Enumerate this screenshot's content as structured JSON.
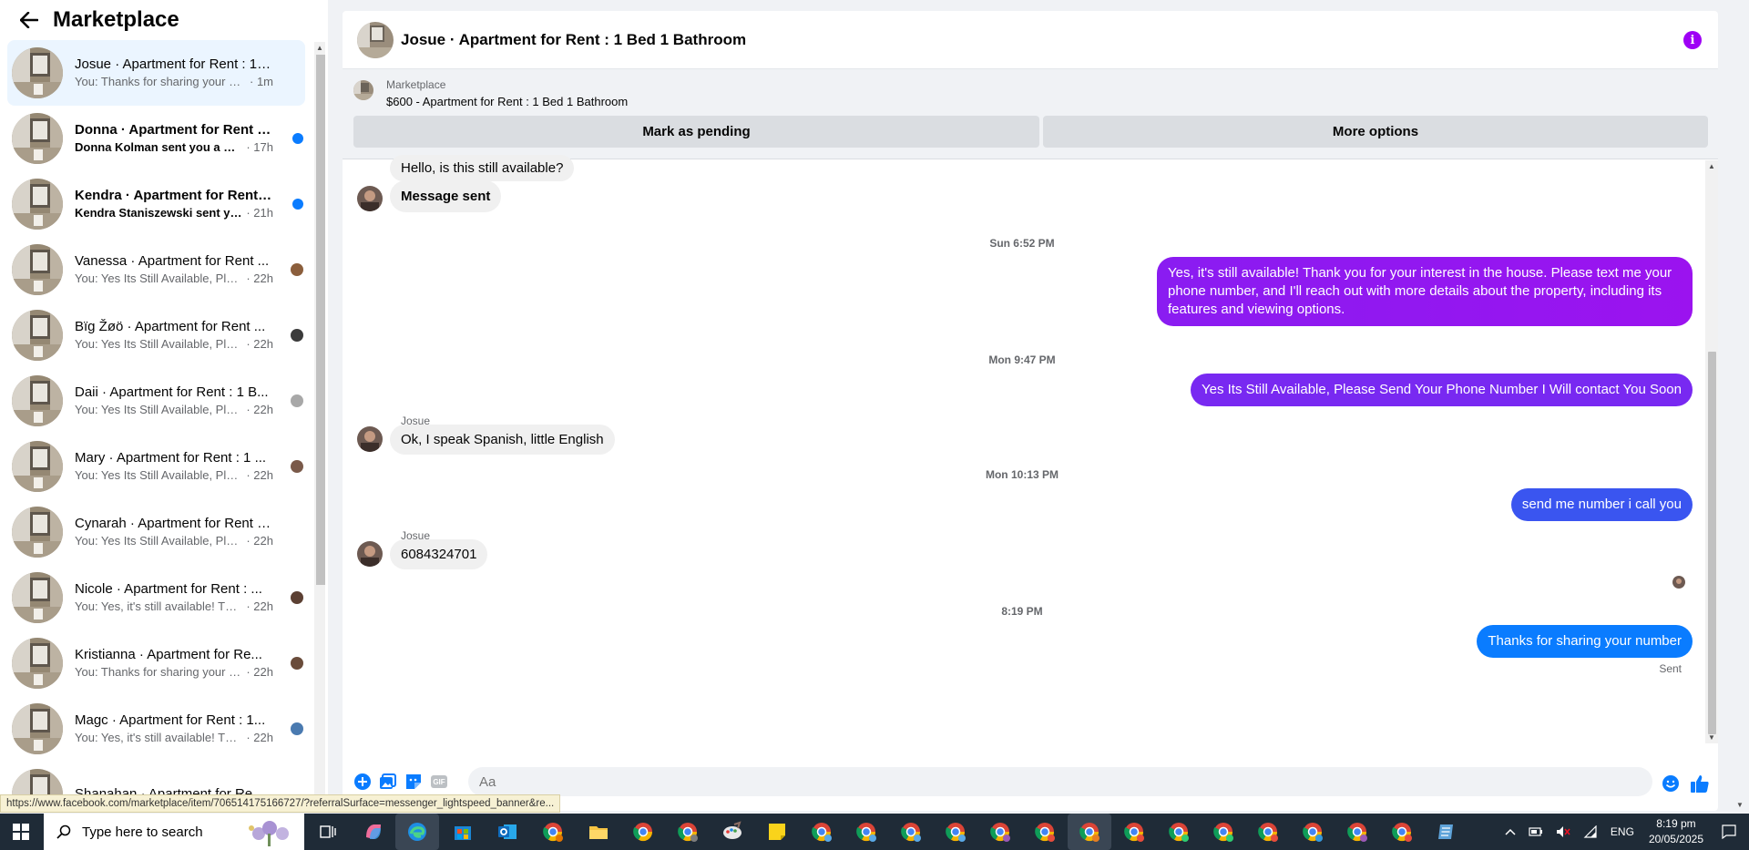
{
  "sidebar": {
    "title": "Marketplace",
    "conversations": [
      {
        "name": "Josue · Apartment for Rent : 1 B...",
        "preview": "You: Thanks for sharing your num...",
        "time": "· 1m",
        "active": true,
        "unread": false,
        "end": "none"
      },
      {
        "name": "Donna · Apartment for Rent : ...",
        "preview": "Donna Kolman sent you a mes...",
        "time": "· 17h",
        "active": false,
        "unread": true,
        "end": "dot"
      },
      {
        "name": "Kendra · Apartment for Rent : ...",
        "preview": "Kendra Staniszewski sent you ...",
        "time": "· 21h",
        "active": false,
        "unread": true,
        "end": "dot"
      },
      {
        "name": "Vanessa · Apartment for Rent ...",
        "preview": "You: Yes Its Still Available, Pleas...",
        "time": "· 22h",
        "active": false,
        "unread": false,
        "end": "avatar"
      },
      {
        "name": "Bïg Žøö · Apartment for Rent ...",
        "preview": "You: Yes Its Still Available, Pleas...",
        "time": "· 22h",
        "active": false,
        "unread": false,
        "end": "avatar"
      },
      {
        "name": "Daii · Apartment for Rent : 1 B...",
        "preview": "You: Yes Its Still Available, Pleas...",
        "time": "· 22h",
        "active": false,
        "unread": false,
        "end": "avatar"
      },
      {
        "name": "Mary · Apartment for Rent : 1 ...",
        "preview": "You: Yes Its Still Available, Pleas...",
        "time": "· 22h",
        "active": false,
        "unread": false,
        "end": "avatar"
      },
      {
        "name": "Cynarah · Apartment for Rent : 1...",
        "preview": "You: Yes Its Still Available, Please S...",
        "time": "· 22h",
        "active": false,
        "unread": false,
        "end": "none"
      },
      {
        "name": "Nicole · Apartment for Rent : ...",
        "preview": "You: Yes, it's still available! Tha...",
        "time": "· 22h",
        "active": false,
        "unread": false,
        "end": "avatar"
      },
      {
        "name": "Kristianna · Apartment for Re...",
        "preview": "You: Thanks for sharing your n...",
        "time": "· 22h",
        "active": false,
        "unread": false,
        "end": "avatar"
      },
      {
        "name": "Magc · Apartment for Rent : 1...",
        "preview": "You: Yes, it's still available! Tha...",
        "time": "· 22h",
        "active": false,
        "unread": false,
        "end": "avatar"
      },
      {
        "name": "Shanahan · Apartment for Rent ...",
        "preview": "",
        "time": "",
        "active": false,
        "unread": false,
        "end": "none"
      }
    ]
  },
  "chat": {
    "title": "Josue · Apartment for Rent : 1 Bed 1 Bathroom",
    "listing": {
      "category": "Marketplace",
      "title": "$600 - Apartment for Rent : 1 Bed 1 Bathroom",
      "pending_label": "Mark as pending",
      "more_label": "More options"
    },
    "messages": {
      "m1": "Hello, is this still available?",
      "m2": "Message sent",
      "ts1": "Sun 6:52 PM",
      "m3": "Yes, it's still available! Thank you for your interest in the house. Please text me your phone number, and I'll reach out with more details about the property, including its features and viewing options.",
      "ts2": "Mon 9:47 PM",
      "m4": "Yes Its Still Available, Please Send Your Phone Number I Will contact You Soon",
      "sender1": "Josue",
      "m5": "Ok, I speak Spanish, little English",
      "ts3": "Mon 10:13 PM",
      "m6": "send me number i call you",
      "sender2": "Josue",
      "m7": "6084324701",
      "ts4": "8:19 PM",
      "m8": "Thanks for sharing your number",
      "status": "Sent"
    },
    "composer": {
      "placeholder": "Aa",
      "gif_label": "GIF"
    }
  },
  "status_url": "https://www.facebook.com/marketplace/item/706514175166727/?referralSurface=messenger_lightspeed_banner&re...",
  "taskbar": {
    "search_placeholder": "Type here to search",
    "language": "ENG",
    "time": "8:19 pm",
    "date": "20/05/2025"
  },
  "colors": {
    "accent_purple": "#9e00f5",
    "bubble_purple": "#8a1cf1",
    "bubble_blue": "#2b5ff0",
    "bubble_light_blue": "#0a7cff",
    "unread_dot": "#0a7cff"
  }
}
